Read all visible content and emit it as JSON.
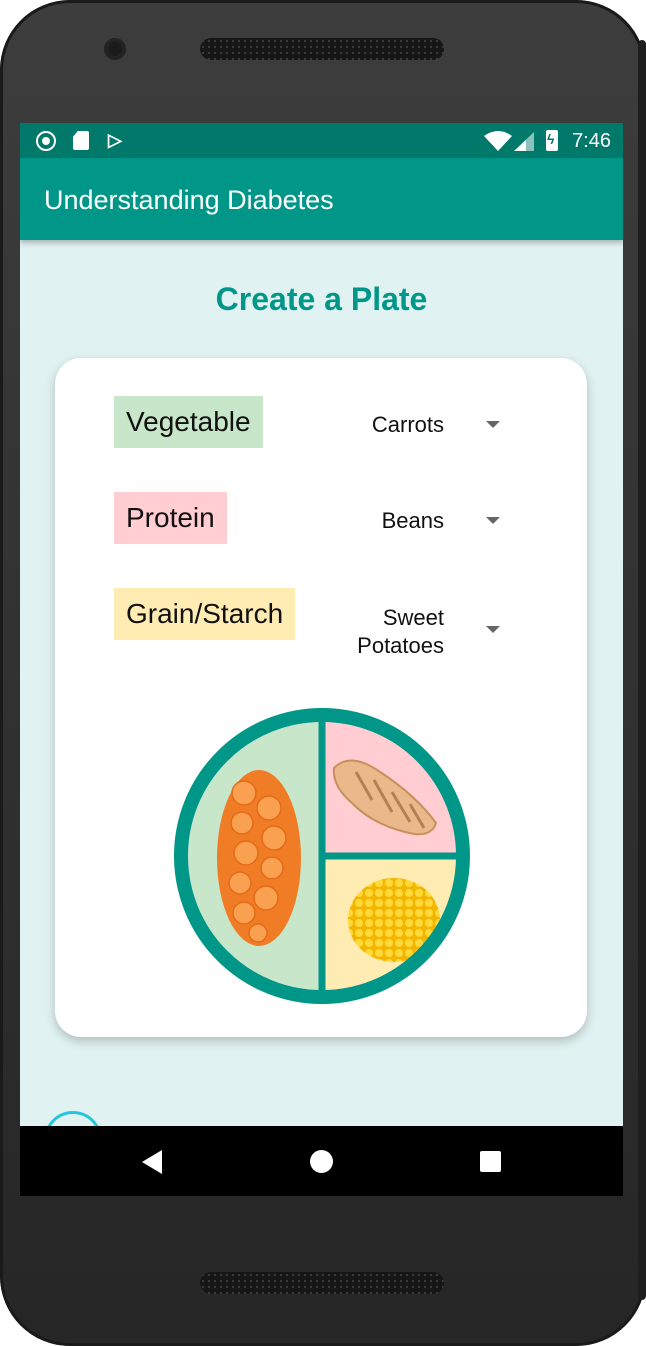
{
  "status_bar": {
    "time": "7:46",
    "left_icons": [
      "circle-icon",
      "sd-card-icon",
      "play-store-icon"
    ],
    "right_icons": [
      "wifi-icon",
      "cell-signal-icon",
      "battery-charging-icon"
    ]
  },
  "app_bar": {
    "title": "Understanding Diabetes"
  },
  "page": {
    "title": "Create a Plate"
  },
  "plate_builder": {
    "rows": [
      {
        "category": "Vegetable",
        "selected": "Carrots",
        "color": "#c8e6c9"
      },
      {
        "category": "Protein",
        "selected": "Beans",
        "color": "#ffcdd2"
      },
      {
        "category": "Grain/Starch",
        "selected": "Sweet Potatoes",
        "color": "#ffecb3"
      }
    ]
  },
  "plate": {
    "rim_color": "#009688",
    "sections": [
      {
        "name": "vegetable",
        "image": "carrots-image",
        "color": "#c8e6c9"
      },
      {
        "name": "protein",
        "image": "grilled-chicken-image",
        "color": "#ffcdd2"
      },
      {
        "name": "grain",
        "image": "corn-image",
        "color": "#ffecb3"
      }
    ]
  },
  "nav_bar": {
    "icons": [
      "back-icon",
      "home-icon",
      "recent-apps-icon"
    ]
  },
  "colors": {
    "primary": "#009688",
    "primary_dark": "#00796b",
    "background": "#e0f2f1"
  }
}
